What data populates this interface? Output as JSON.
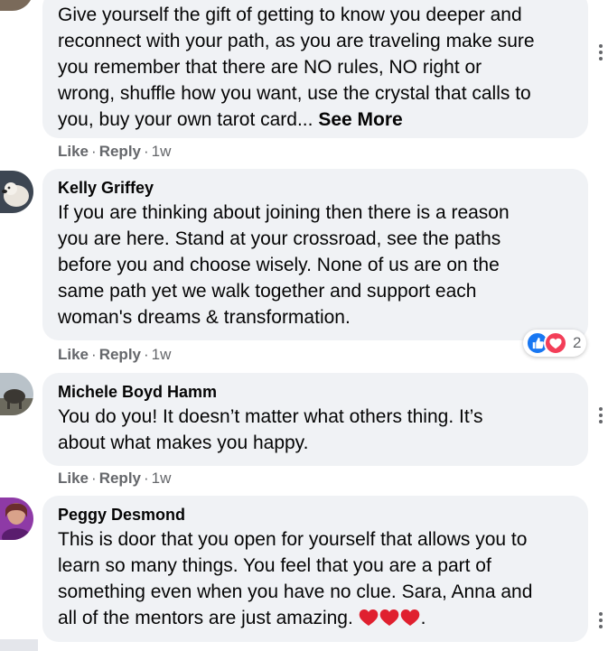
{
  "comments": [
    {
      "author": "",
      "text": "Give yourself the gift of getting to know you deeper and\nreconnect with your path, as you are traveling make sure\nyou remember that there are NO rules, NO right or\nwrong, shuffle how you want, use the crystal that calls to\nyou, buy your own tarot card... ",
      "see_more": "See More",
      "like": "Like",
      "reply": "Reply",
      "time": "1w"
    },
    {
      "author": "Kelly Griffey",
      "text": "If you are thinking about joining then there is a reason\nyou are here. Stand at your crossroad, see the paths\nbefore you and choose wisely. None of us are on the\nsame path yet we walk together and support each\nwoman's dreams & transformation.",
      "like": "Like",
      "reply": "Reply",
      "time": "1w",
      "reaction_count": "2"
    },
    {
      "author": "Michele Boyd Hamm",
      "text": "You do you! It doesn’t matter what others thing. It’s\nabout what makes you happy.",
      "like": "Like",
      "reply": "Reply",
      "time": "1w"
    },
    {
      "author": "Peggy Desmond",
      "text": "This is door that you open for yourself that allows you to\nlearn so many things. You feel that you are a part of\nsomething even when you have no clue. Sara, Anna and\nall of the mentors are just amazing. ",
      "text_end": ".",
      "like": "Like",
      "reply": "Reply",
      "time": "1w"
    }
  ],
  "icons": {
    "more": "more-options-icon",
    "like_reaction": "like-reaction-icon",
    "love_reaction": "love-reaction-icon",
    "heart_emoji": "heart-emoji-icon"
  },
  "colors": {
    "bubble": "#f0f2f5",
    "secondary_text": "#65676b",
    "like_blue": "#1877f2",
    "love_red": "#f33e58",
    "heart_emoji": "#e0202f"
  }
}
